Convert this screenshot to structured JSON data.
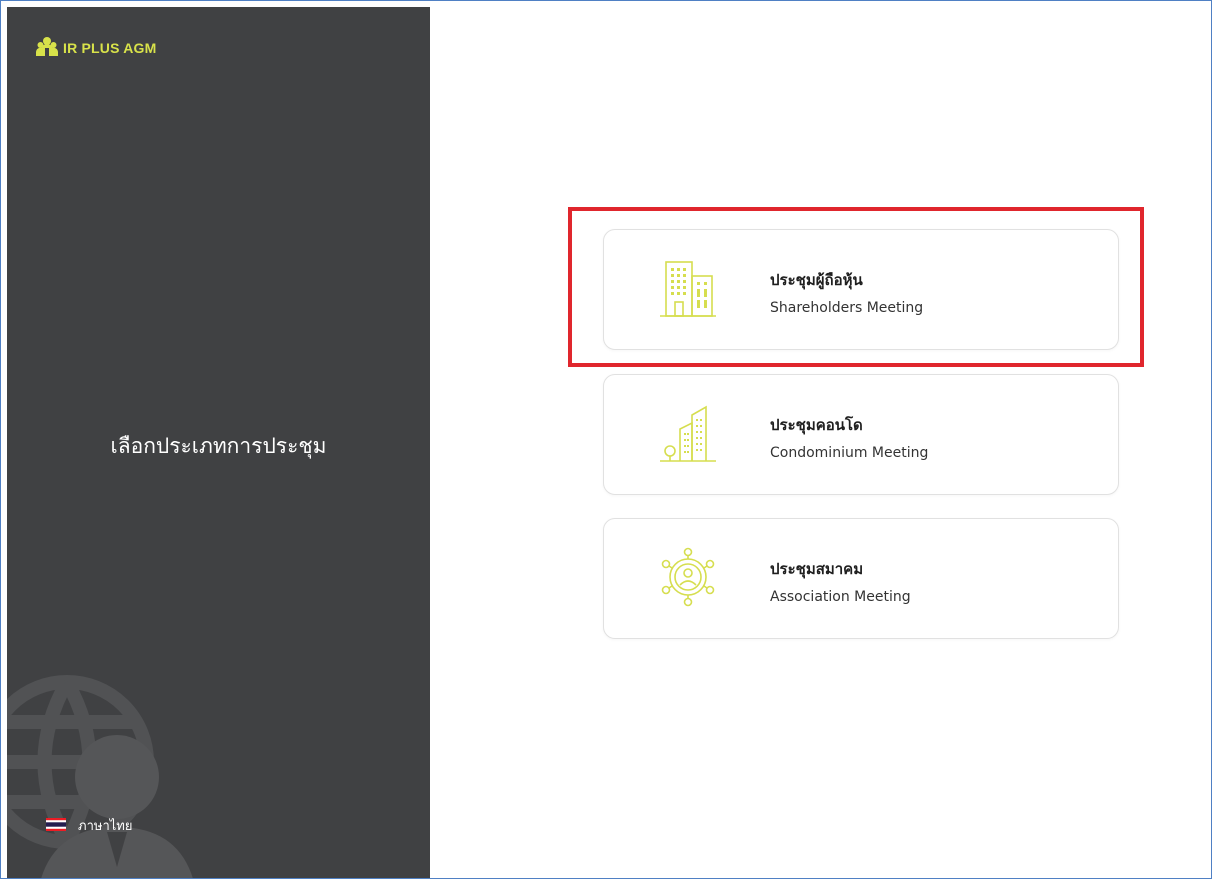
{
  "brand": {
    "name": "IR PLUS AGM",
    "icon": "logo-people-icon",
    "color": "#d8e24a"
  },
  "sidebar": {
    "title": "เลือกประเภทการประชุม",
    "background": "#404143"
  },
  "language": {
    "label": "ภาษาไทย",
    "icon": "thai-flag-icon"
  },
  "meetings": [
    {
      "title": "ประชุมผู้ถือหุ้น",
      "subtitle": "Shareholders Meeting",
      "icon": "office-buildings-icon",
      "highlighted": true
    },
    {
      "title": "ประชุมคอนโด",
      "subtitle": "Condominium Meeting",
      "icon": "condominium-tower-icon",
      "highlighted": false
    },
    {
      "title": "ประชุมสมาคม",
      "subtitle": "Association Meeting",
      "icon": "association-network-icon",
      "highlighted": false
    }
  ],
  "colors": {
    "accent": "#d8e24a",
    "highlight": "#e0262d"
  }
}
